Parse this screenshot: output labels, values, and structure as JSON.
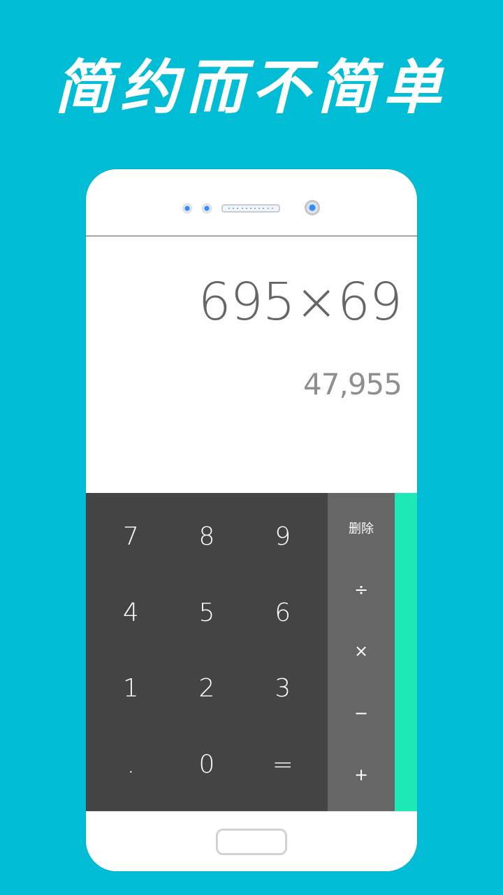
{
  "headline": "简约而不简单",
  "display": {
    "formula": "695×69",
    "result": "47,955"
  },
  "keypad": {
    "keys": [
      "7",
      "8",
      "9",
      "4",
      "5",
      "6",
      "1",
      "2",
      "3",
      ".",
      "0",
      "="
    ]
  },
  "operators": {
    "delete": "删除",
    "divide": "÷",
    "multiply": "×",
    "subtract": "−",
    "add": "+"
  },
  "colors": {
    "background": "#00bcd4",
    "keypad": "#444444",
    "operators": "#666666",
    "advanced_panel": "#1de9b6"
  }
}
